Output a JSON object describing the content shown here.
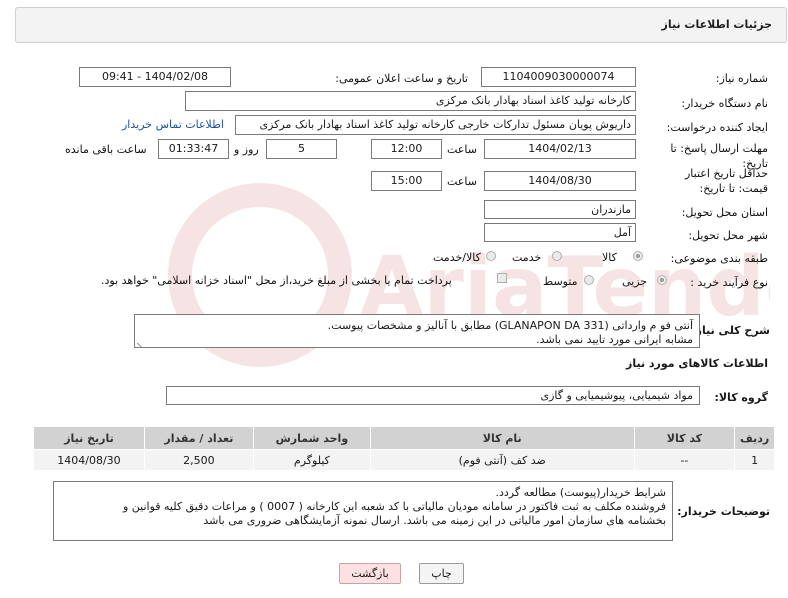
{
  "header": {
    "title": "جزئیات اطلاعات نیاز"
  },
  "labels": {
    "need_number": "شماره نیاز:",
    "announce_datetime": "تاریخ و ساعت اعلان عمومی:",
    "buyer_org": "نام دستگاه خریدار:",
    "requester": "ایجاد کننده درخواست:",
    "reply_deadline": "مهلت ارسال پاسخ: تا تاریخ:",
    "time": "ساعت",
    "day_and": "روز و",
    "remaining": "ساعت باقی مانده",
    "price_validity": "حداقل تاریخ اعتبار قیمت: تا تاریخ:",
    "delivery_province": "استان محل تحویل:",
    "delivery_city": "شهر محل تحویل:",
    "category": "طبقه بندی موضوعی:",
    "purchase_process": "نوع فرآیند خرید :",
    "general_desc": "شرح کلی نیاز:",
    "goods_info": "اطلاعات کالاهای مورد نیاز",
    "goods_group": "گروه کالا:",
    "buyer_notes": "توضیحات خریدار:"
  },
  "fields": {
    "need_number": "1104009030000074",
    "announce_datetime": "1404/02/08 - 09:41",
    "buyer_org": "کارخانه تولید کاغذ اسناد بهادار بانک مرکزی",
    "requester": "داریوش  پویان مسئول تدارکات خارجی کارخانه تولید کاغذ اسناد بهادار بانک مرکزی",
    "contact_link": "اطلاعات تماس خریدار",
    "reply_date": "1404/02/13",
    "reply_time": "12:00",
    "reply_days": "5",
    "reply_remaining": "01:33:47",
    "validity_date": "1404/08/30",
    "validity_time": "15:00",
    "province": "مازندران",
    "city": "آمل",
    "goods_group": "مواد شیمیایی، پیوشیمیایی و  گازی"
  },
  "category_options": [
    "کالا",
    "خدمت",
    "کالا/خدمت"
  ],
  "category_selected": "کالا",
  "process_options": [
    "جزیی",
    "متوسط"
  ],
  "process_selected": "جزیی",
  "process_note": "پرداخت تمام یا بخشی از مبلغ خرید،از محل \"اسناد خزانه اسلامی\" خواهد بود.",
  "general_desc_lines": [
    "آنتی فو م وارداتی (GLANAPON DA 331) مطابق با آنالیز و مشخصات پیوست.",
    "مشابه ایرانی مورد تایید نمی باشد."
  ],
  "table": {
    "headers": [
      "ردیف",
      "کد کالا",
      "نام کالا",
      "واحد شمارش",
      "تعداد / مقدار",
      "تاریخ نیاز"
    ],
    "rows": [
      [
        "1",
        "--",
        "ضد کف (آنتی فوم)",
        "کیلوگرم",
        "2,500",
        "1404/08/30"
      ]
    ]
  },
  "buyer_notes_lines": [
    "شرایط  خریدار(پیوست) مطالعه گردد.",
    "فروشنده مکلف به ثبت فاکتور در سامانه مودیان مالیاتی با کد شعبه این کارخانه ( 0007 ) و مراعات دقیق کلیه قوانین و",
    "بخشنامه های سازمان امور مالیاتی در این زمینه می باشد.  ارسال نمونه آزمایشگاهی ضروری می باشد"
  ],
  "buttons": {
    "print": "چاپ",
    "back": "بازگشت"
  },
  "watermark": {
    "text": "AriaTender.neT"
  },
  "colors": {
    "link": "#1f4e9e",
    "table_header": "#d2d2d2",
    "back_button": "#fbe1e1"
  }
}
